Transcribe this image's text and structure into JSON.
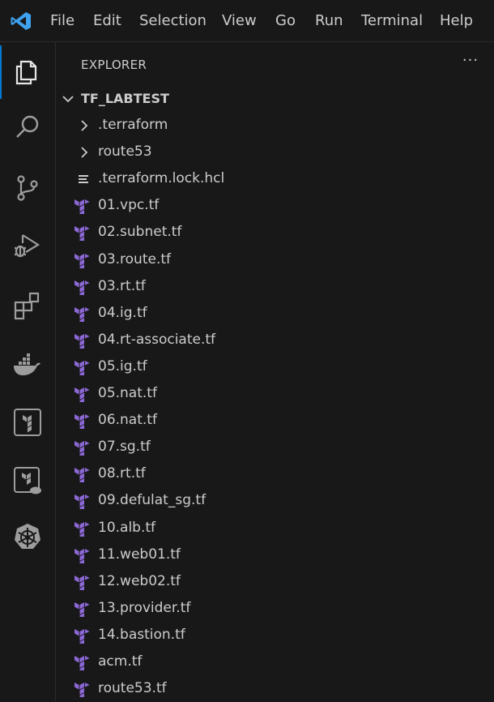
{
  "menu": {
    "items": [
      "File",
      "Edit",
      "Selection",
      "View",
      "Go",
      "Run",
      "Terminal",
      "Help"
    ]
  },
  "activity_bar": {
    "icons": [
      "explorer-icon",
      "search-icon",
      "source-control-icon",
      "run-debug-icon",
      "extensions-icon",
      "docker-icon",
      "terraform-icon",
      "terraform-cloud-icon",
      "kubernetes-icon"
    ]
  },
  "sidebar": {
    "title": "EXPLORER",
    "more": "···",
    "folder": "TF_LABTEST",
    "items": [
      {
        "label": ".terraform",
        "kind": "folder"
      },
      {
        "label": "route53",
        "kind": "folder"
      },
      {
        "label": ".terraform.lock.hcl",
        "kind": "lock"
      },
      {
        "label": "01.vpc.tf",
        "kind": "tf"
      },
      {
        "label": "02.subnet.tf",
        "kind": "tf"
      },
      {
        "label": "03.route.tf",
        "kind": "tf"
      },
      {
        "label": "03.rt.tf",
        "kind": "tf"
      },
      {
        "label": "04.ig.tf",
        "kind": "tf"
      },
      {
        "label": "04.rt-associate.tf",
        "kind": "tf"
      },
      {
        "label": "05.ig.tf",
        "kind": "tf"
      },
      {
        "label": "05.nat.tf",
        "kind": "tf"
      },
      {
        "label": "06.nat.tf",
        "kind": "tf"
      },
      {
        "label": "07.sg.tf",
        "kind": "tf"
      },
      {
        "label": "08.rt.tf",
        "kind": "tf"
      },
      {
        "label": "09.defulat_sg.tf",
        "kind": "tf"
      },
      {
        "label": "10.alb.tf",
        "kind": "tf"
      },
      {
        "label": "11.web01.tf",
        "kind": "tf"
      },
      {
        "label": "12.web02.tf",
        "kind": "tf"
      },
      {
        "label": "13.provider.tf",
        "kind": "tf"
      },
      {
        "label": "14.bastion.tf",
        "kind": "tf"
      },
      {
        "label": "acm.tf",
        "kind": "tf"
      },
      {
        "label": "route53.tf",
        "kind": "tf"
      }
    ]
  },
  "colors": {
    "background": "#181818",
    "text": "#cccccc",
    "accent": "#0078d4",
    "vscode_blue": "#3ea2f0",
    "terraform_purple": "#8b68d6"
  }
}
